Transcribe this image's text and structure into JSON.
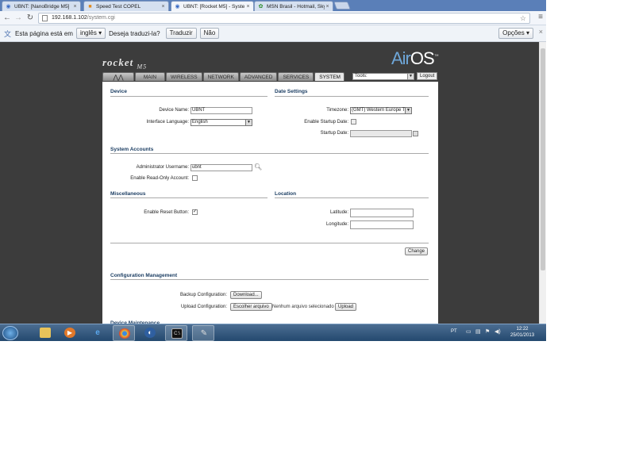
{
  "browser": {
    "tabs": [
      {
        "title": "UBNT: [NanoBridge M5]",
        "icon": "ubnt-favicon"
      },
      {
        "title": "Speed Test COPEL",
        "icon": "speedtest-favicon"
      },
      {
        "title": "UBNT: [Rocket M5] - Syste",
        "icon": "ubnt-favicon"
      },
      {
        "title": "MSN Brasil - Hotmail, Skyp",
        "icon": "msn-favicon"
      }
    ],
    "url_host": "192.168.1.102",
    "url_path": "/system.cgi"
  },
  "translate_bar": {
    "prefix": "Esta página está em",
    "language": "inglês",
    "question": "Deseja traduzi-la?",
    "translate_button": "Traduzir",
    "no_button": "Não",
    "options_button": "Opções"
  },
  "airos": {
    "product": "rocket",
    "model": "M5",
    "brand": "Air",
    "brand2": "OS",
    "tabs": [
      "MAIN",
      "WIRELESS",
      "NETWORK",
      "ADVANCED",
      "SERVICES",
      "SYSTEM"
    ],
    "active_tab": "SYSTEM",
    "tools_label": "Tools:",
    "logout_label": "Logout",
    "device": {
      "heading": "Device",
      "name_label": "Device Name:",
      "name_value": "UBNT",
      "lang_label": "Interface Language:",
      "lang_value": "English"
    },
    "date": {
      "heading": "Date Settings",
      "tz_label": "Timezone:",
      "tz_value": "(GMT) Western Europe T",
      "startup_enable_label": "Enable Startup Date:",
      "startup_date_label": "Startup Date:"
    },
    "accounts": {
      "heading": "System Accounts",
      "admin_label": "Administrator Username:",
      "admin_value": "ubnt",
      "readonly_label": "Enable Read-Only Account:"
    },
    "misc": {
      "heading": "Miscellaneous",
      "reset_label": "Enable Reset Button:",
      "reset_checked": true
    },
    "location": {
      "heading": "Location",
      "lat_label": "Latitude:",
      "lon_label": "Longitude:"
    },
    "change_button": "Change",
    "config": {
      "heading": "Configuration Management",
      "backup_label": "Backup Configuration:",
      "download_button": "Download...",
      "upload_label": "Upload Configuration:",
      "choose_file_button": "Escolher arquivo",
      "no_file_text": "Nenhum arquivo selecionado",
      "upload_button": "Upload"
    },
    "maintenance_heading": "Device Maintenance"
  },
  "taskbar": {
    "language": "PT",
    "time": "12:22",
    "date": "25/01/2013"
  }
}
